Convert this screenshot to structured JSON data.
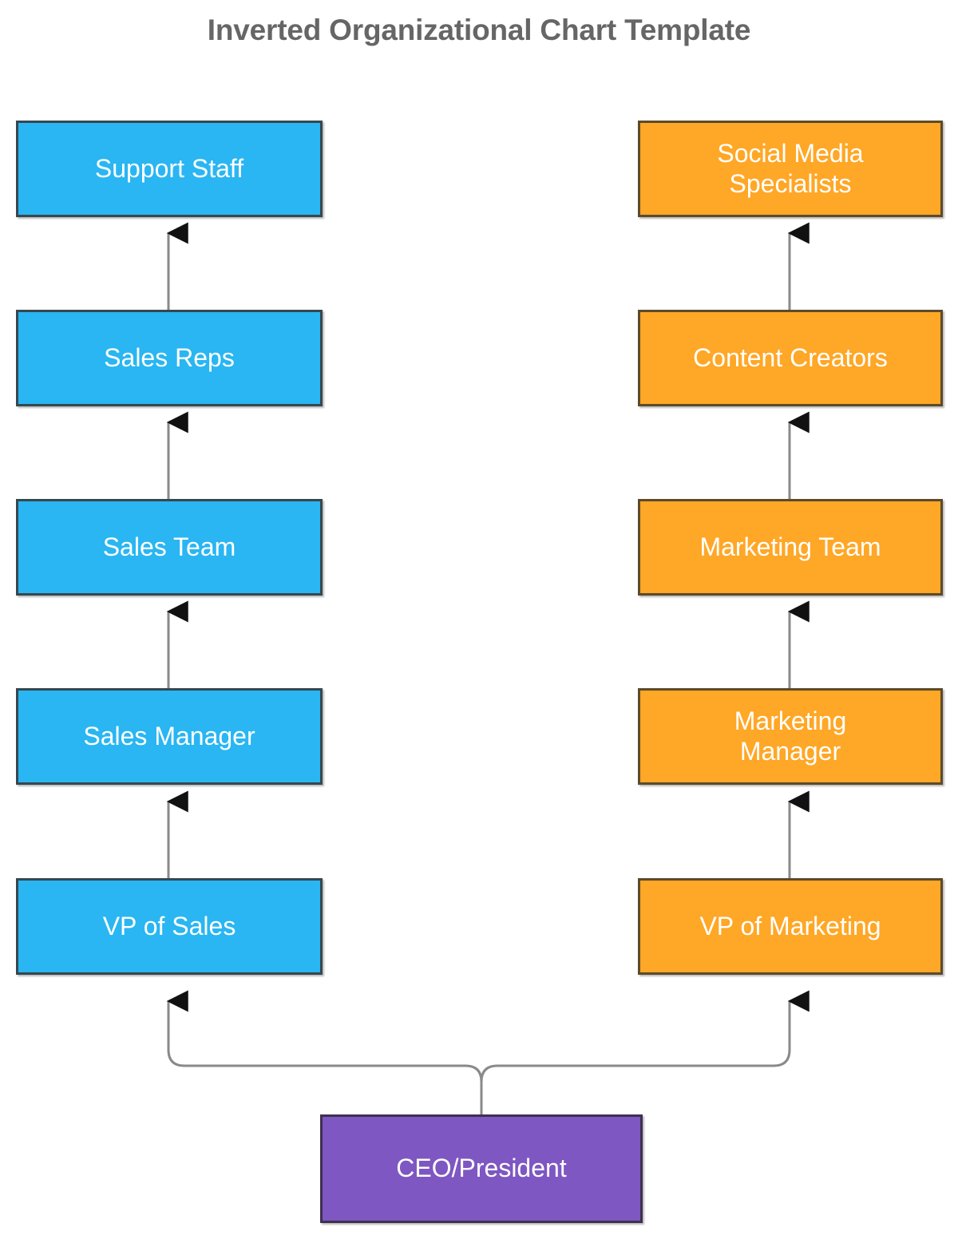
{
  "title": "Inverted Organizational Chart Template",
  "colors": {
    "blue_fill": "#29b6f2",
    "blue_border": "#37474f",
    "orange_fill": "#ffa726",
    "orange_border": "#5d4a2a",
    "purple_fill": "#7e57c2",
    "purple_border": "#3f3050",
    "title_text": "#666666",
    "node_text": "#ffffff",
    "connector_line": "#8a8a8a",
    "arrow_head": "#111111",
    "background": "#ffffff"
  },
  "chart_data": {
    "type": "diagram",
    "diagram_type": "inverted-organizational-chart",
    "title": "Inverted Organizational Chart Template",
    "orientation": "bottom-up",
    "root": "CEO/President",
    "branches": [
      {
        "name": "Sales",
        "color": "#29b6f2",
        "nodes": [
          "VP of Sales",
          "Sales Manager",
          "Sales Team",
          "Sales Reps",
          "Support Staff"
        ]
      },
      {
        "name": "Marketing",
        "color": "#ffa726",
        "nodes": [
          "VP of Marketing",
          "Marketing Manager",
          "Marketing Team",
          "Content Creators",
          "Social Media Specialists"
        ]
      }
    ],
    "edges": [
      {
        "from": "CEO/President",
        "to": "VP of Sales",
        "style": "curved-branch",
        "arrow": "up"
      },
      {
        "from": "CEO/President",
        "to": "VP of Marketing",
        "style": "curved-branch",
        "arrow": "up"
      },
      {
        "from": "VP of Sales",
        "to": "Sales Manager",
        "style": "straight",
        "arrow": "up"
      },
      {
        "from": "Sales Manager",
        "to": "Sales Team",
        "style": "straight",
        "arrow": "up"
      },
      {
        "from": "Sales Team",
        "to": "Sales Reps",
        "style": "straight",
        "arrow": "up"
      },
      {
        "from": "Sales Reps",
        "to": "Support Staff",
        "style": "straight",
        "arrow": "up"
      },
      {
        "from": "VP of Marketing",
        "to": "Marketing Manager",
        "style": "straight",
        "arrow": "up"
      },
      {
        "from": "Marketing Manager",
        "to": "Marketing Team",
        "style": "straight",
        "arrow": "up"
      },
      {
        "from": "Marketing Team",
        "to": "Content Creators",
        "style": "straight",
        "arrow": "up"
      },
      {
        "from": "Content Creators",
        "to": "Social Media Specialists",
        "style": "straight",
        "arrow": "up"
      }
    ]
  },
  "nodes": {
    "support_staff": "Support Staff",
    "sales_reps": "Sales Reps",
    "sales_team": "Sales Team",
    "sales_manager": "Sales Manager",
    "vp_of_sales": "VP of Sales",
    "social_media_specialists": "Social Media\nSpecialists",
    "content_creators": "Content Creators",
    "marketing_team": "Marketing Team",
    "marketing_manager": "Marketing\nManager",
    "vp_of_marketing": "VP of Marketing",
    "ceo_president": "CEO/President"
  }
}
